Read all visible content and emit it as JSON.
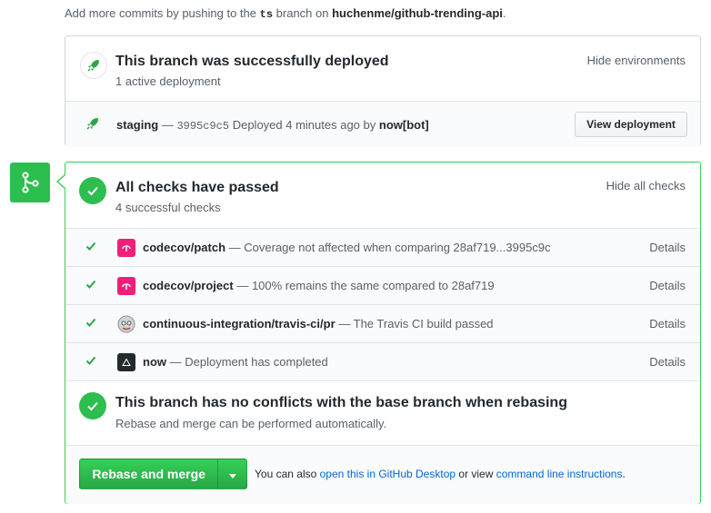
{
  "top_note": {
    "prefix": "Add more commits by pushing to the",
    "branch": "ts",
    "middle": "branch on",
    "repo": "huchenme/github-trending-api",
    "suffix": "."
  },
  "deployment": {
    "title": "This branch was successfully deployed",
    "subtitle": "1 active deployment",
    "hide_link": "Hide environments",
    "row": {
      "environment": "staging",
      "separator": " — ",
      "commit": "3995c9c5",
      "text": "Deployed 4 minutes ago by",
      "actor": "now[bot]",
      "button": "View deployment"
    }
  },
  "checks": {
    "title": "All checks have passed",
    "subtitle": "4 successful checks",
    "hide_link": "Hide all checks",
    "items": [
      {
        "name": "codecov/patch",
        "description": "— Coverage not affected when comparing 28af719...3995c9c",
        "details": "Details",
        "icon": "codecov-icon"
      },
      {
        "name": "codecov/project",
        "description": "— 100% remains the same compared to 28af719",
        "details": "Details",
        "icon": "codecov-icon"
      },
      {
        "name": "continuous-integration/travis-ci/pr",
        "description": "— The Travis CI build passed",
        "details": "Details",
        "icon": "travis-icon"
      },
      {
        "name": "now",
        "description": "— Deployment has completed",
        "details": "Details",
        "icon": "now-icon"
      }
    ]
  },
  "conflicts": {
    "title": "This branch has no conflicts with the base branch when rebasing",
    "subtitle": "Rebase and merge can be performed automatically."
  },
  "merge": {
    "button": "Rebase and merge",
    "note_prefix": "You can also",
    "desktop_link": "open this in GitHub Desktop",
    "note_middle": "or view",
    "cli_link": "command line instructions",
    "note_suffix": "."
  },
  "colors": {
    "success": "#2cbe4e",
    "border_success": "#34d058",
    "link": "#0366d6",
    "codecov": "#f01f7a"
  }
}
